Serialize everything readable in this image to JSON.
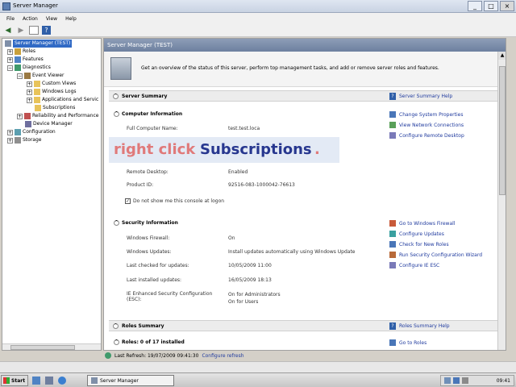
{
  "window": {
    "title": "Server Manager",
    "buttons": [
      "_",
      "□",
      "×"
    ]
  },
  "menu": [
    "File",
    "Action",
    "View",
    "Help"
  ],
  "toolbar": {
    "help": "?"
  },
  "tree": [
    {
      "label": "Server Manager (TEST)",
      "indent": 0,
      "expander": "",
      "icon": "server-icon",
      "selected": true
    },
    {
      "label": "Roles",
      "indent": 1,
      "expander": "+",
      "icon": "roles-icon"
    },
    {
      "label": "Features",
      "indent": 1,
      "expander": "+",
      "icon": "features-icon"
    },
    {
      "label": "Diagnostics",
      "indent": 1,
      "expander": "−",
      "icon": "diagnostics-icon"
    },
    {
      "label": "Event Viewer",
      "indent": 2,
      "expander": "−",
      "icon": "event-viewer-icon"
    },
    {
      "label": "Custom Views",
      "indent": 3,
      "expander": "+",
      "icon": "folder-icon"
    },
    {
      "label": "Windows Logs",
      "indent": 3,
      "expander": "+",
      "icon": "folder-icon"
    },
    {
      "label": "Applications and Servic",
      "indent": 3,
      "expander": "+",
      "icon": "folder-icon"
    },
    {
      "label": "Subscriptions",
      "indent": 3,
      "expander": "",
      "icon": "folder-icon"
    },
    {
      "label": "Reliability and Performance",
      "indent": 2,
      "expander": "+",
      "icon": "performance-icon"
    },
    {
      "label": "Device Manager",
      "indent": 2,
      "expander": "",
      "icon": "device-manager-icon"
    },
    {
      "label": "Configuration",
      "indent": 1,
      "expander": "+",
      "icon": "configuration-icon"
    },
    {
      "label": "Storage",
      "indent": 1,
      "expander": "+",
      "icon": "storage-icon"
    }
  ],
  "main": {
    "header": "Server Manager (TEST)",
    "intro": "Get an overview of the status of this server, perform top management tasks, and add or remove server roles and features.",
    "server_summary": {
      "title": "Server Summary",
      "help": "Server Summary Help",
      "computer_info": {
        "title": "Computer Information",
        "full_name_label": "Full Computer Name:",
        "full_name_value": "test.test.loca",
        "remote_desktop_label": "Remote Desktop:",
        "remote_desktop_value": "Enabled",
        "product_id_label": "Product ID:",
        "product_id_value": "92516-083-1000042-76613",
        "checkbox_label": "Do not show me this console at logon",
        "checked": true,
        "tasks": [
          "Change System Properties",
          "View Network Connections",
          "Configure Remote Desktop"
        ]
      },
      "security_info": {
        "title": "Security Information",
        "rows": [
          {
            "label": "Windows Firewall:",
            "value": "On"
          },
          {
            "label": "Windows Updates:",
            "value": "Install updates automatically using Windows Update"
          },
          {
            "label": "Last checked for updates:",
            "value": "10/05/2009 11:00"
          },
          {
            "label": "Last installed updates:",
            "value": "16/05/2009 18:13"
          },
          {
            "label": "IE Enhanced Security Configuration (ESC):",
            "value": "On for Administrators\nOn for Users"
          }
        ],
        "tasks": [
          "Go to Windows Firewall",
          "Configure Updates",
          "Check for New Roles",
          "Run Security Configuration Wizard",
          "Configure IE ESC"
        ]
      }
    },
    "roles_summary": {
      "title": "Roles Summary",
      "help": "Roles Summary Help",
      "roles_count": "Roles: 0 of 17 installed",
      "task": "Go to Roles"
    },
    "overlay": {
      "part1": "right click",
      "part2": "Subscriptions",
      "part3": "."
    }
  },
  "refresh": {
    "text": "Last Refresh: 19/07/2009 09:41:30",
    "link": "Configure refresh"
  },
  "taskbar": {
    "start": "Start",
    "task": "Server Manager",
    "clock": "09:41"
  }
}
